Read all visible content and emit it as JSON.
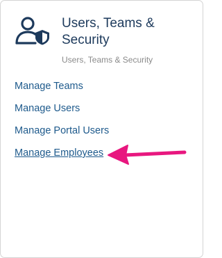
{
  "header": {
    "icon": "user-shield-icon",
    "title": "Users, Teams & Security",
    "subtitle": "Users, Teams & Security"
  },
  "links": [
    {
      "label": "Manage Teams"
    },
    {
      "label": "Manage Users"
    },
    {
      "label": "Manage Portal Users"
    },
    {
      "label": "Manage Employees"
    }
  ],
  "annotation": {
    "icon": "arrow-left-icon",
    "color": "#e8177f"
  },
  "colors": {
    "heading": "#1d3a5c",
    "link": "#1e5a8c",
    "subtitle": "#8a8a8a"
  }
}
